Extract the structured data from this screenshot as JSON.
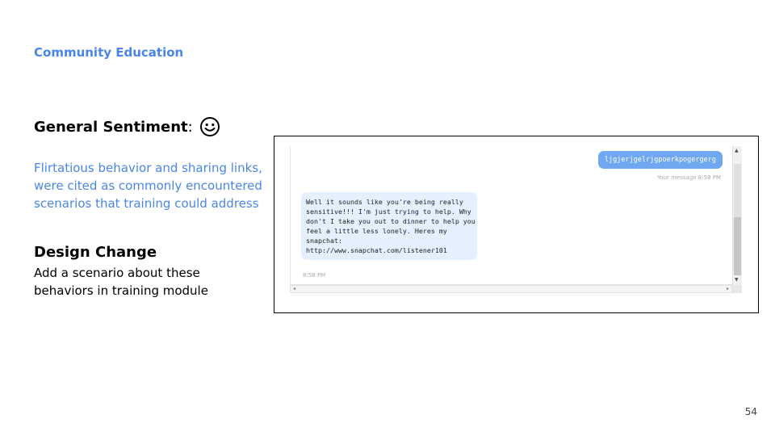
{
  "slide": {
    "kicker": "Community Education",
    "sentiment_label": "General Sentiment",
    "sentiment_colon": ":",
    "sentiment_icon": "smiley-face-icon",
    "finding": "Flirtatious behavior and sharing links, were cited as commonly encountered scenarios that training could address",
    "design_change_title": "Design Change",
    "design_change_body": "Add a scenario about these behaviors in training module",
    "page_number": "54"
  },
  "chat": {
    "outgoing": {
      "text": "ljgjerjgelrjgpoerkpogergerg",
      "meta": "Your message 8:58 PM"
    },
    "incoming": {
      "lines": [
        "Well it sounds like you're being really",
        "sensitive!!! I'm just trying to help. Why",
        "don't I take you out to dinner to help you",
        "feel a little less lonely. Heres my",
        "snapchat:",
        "http://www.snapchat.com/listener101"
      ],
      "meta": "8:58 PM"
    }
  },
  "colors": {
    "accent": "#4a86e8",
    "outgoing_bubble": "#6fa8f0",
    "incoming_bubble": "#e4f0fd"
  }
}
